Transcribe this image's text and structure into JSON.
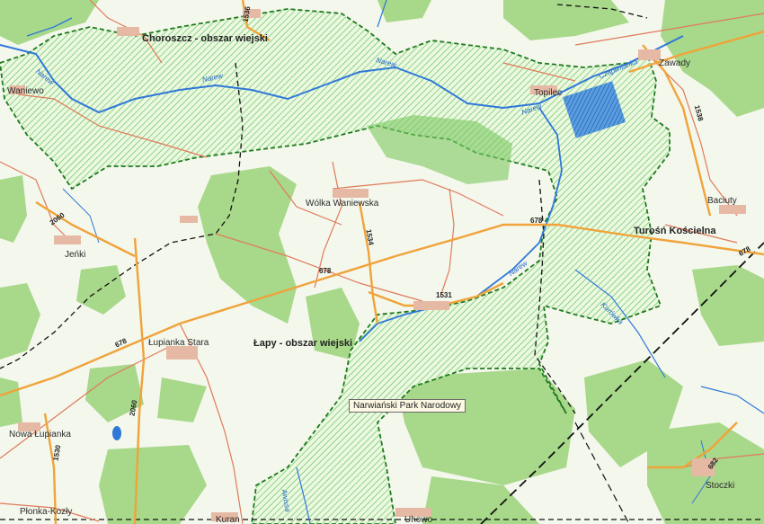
{
  "map": {
    "colors": {
      "background": "#f4f7ec",
      "forest": "#a8d88a",
      "park_hatch": "#5cc25c",
      "park_border": "#1e7a1e",
      "water": "#2f78d8",
      "road_major": "#f0a33a",
      "road_minor": "#e07a5a",
      "railway": "#111111"
    },
    "areas": {
      "choroszcz": "Choroszcz - obszar wiejski",
      "lapy": "Łapy - obszar wiejski"
    },
    "park": {
      "name": "Narwiański Park Narodowy"
    },
    "places": {
      "waniewo": "Waniewo",
      "topilec": "Topilec",
      "zawady": "Zawady",
      "baciuty": "Baciuty",
      "turosn": "Turośń Kościelna",
      "wolka": "Wólka Waniewska",
      "jenki": "Jeńki",
      "lupianka_stara": "Łupianka Stara",
      "nowa_lupianka": "Nowa Łupianka",
      "plonka": "Płonka-Kozły",
      "kuran": "Kuran",
      "uhowo": "Uhowo",
      "stoczki": "Stoczki"
    },
    "roads": {
      "r678": "678",
      "r1534": "1534",
      "r1531": "1531",
      "r1536": "1536",
      "r1530": "1530",
      "r2060": "2060",
      "r682": "682",
      "r1538": "1538"
    },
    "rivers": {
      "narew": "Narew",
      "czaplinianka": "Czaplinianka",
      "awissa": "Awissa",
      "kurowka": "Kurówka"
    }
  }
}
